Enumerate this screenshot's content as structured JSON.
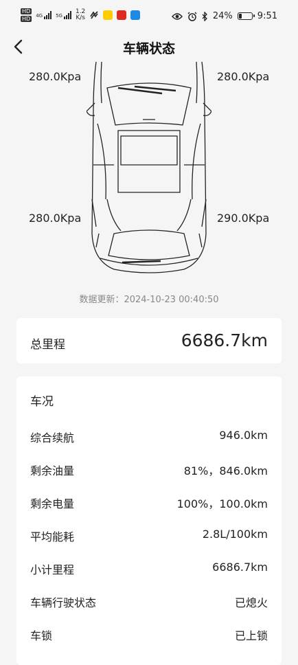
{
  "status_bar": {
    "speed_value": "1.2",
    "speed_unit": "K/s",
    "network_1": "4G",
    "network_2": "5G",
    "hd_label": "HD",
    "battery_percent": "24%",
    "battery_level": 0.24,
    "time": "9:51"
  },
  "header": {
    "title": "车辆状态"
  },
  "tires": {
    "front_left": "280.0Kpa",
    "front_right": "280.0Kpa",
    "rear_left": "280.0Kpa",
    "rear_right": "290.0Kpa"
  },
  "update_time": "数据更新：2024-10-23 00:40:50",
  "odometer": {
    "label": "总里程",
    "value": "6686.7km"
  },
  "vehicle_status": {
    "title": "车况",
    "rows": [
      {
        "label": "综合续航",
        "value": "946.0km"
      },
      {
        "label": "剩余油量",
        "value": "81%，846.0km"
      },
      {
        "label": "剩余电量",
        "value": "100%，100.0km"
      },
      {
        "label": "平均能耗",
        "value": "2.8L/100km"
      },
      {
        "label": "小计里程",
        "value": "6686.7km"
      },
      {
        "label": "车辆行驶状态",
        "value": "已熄火"
      },
      {
        "label": "车锁",
        "value": "已上锁"
      }
    ]
  },
  "colors": {
    "background": "#f5f5f5",
    "card": "#ffffff",
    "text": "#222222",
    "muted": "#888888"
  }
}
